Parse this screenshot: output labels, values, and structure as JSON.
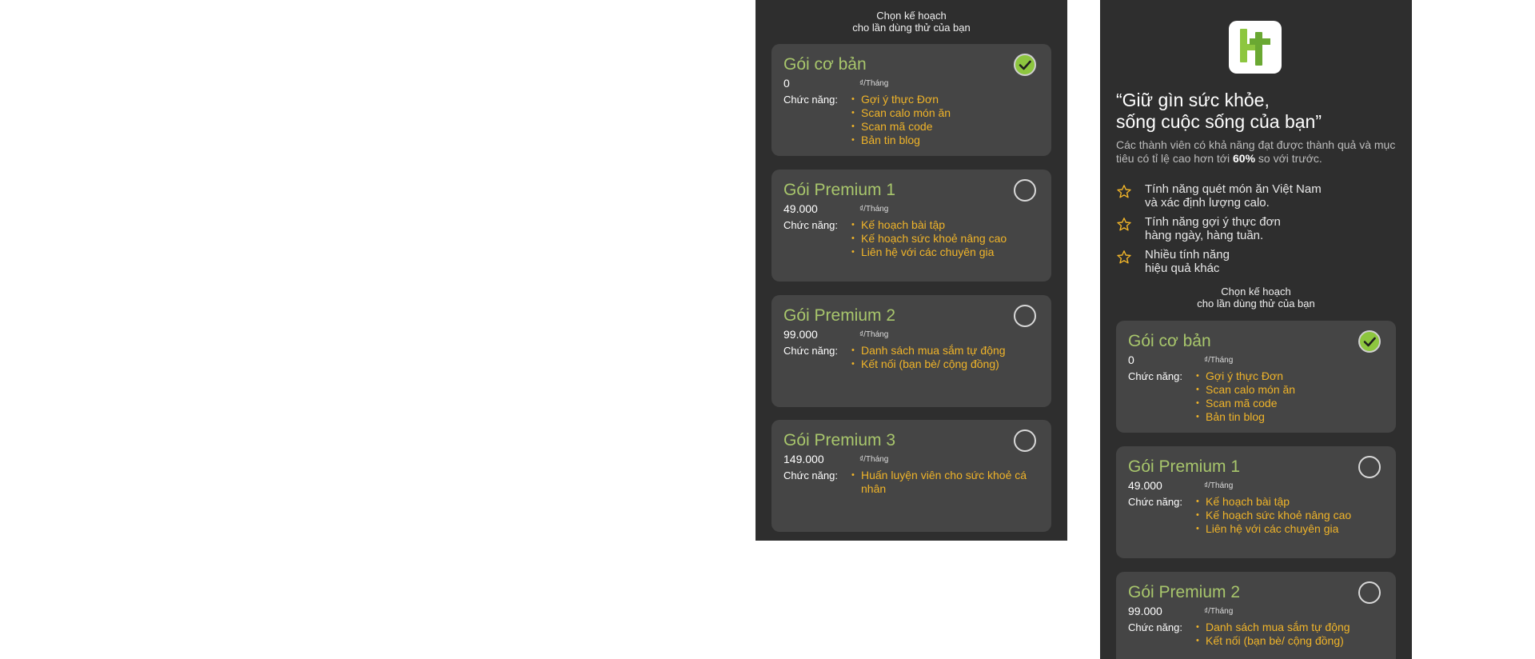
{
  "choose_plan": {
    "line1": "Chọn kế hoạch",
    "line2": "cho lần dùng thử của bạn"
  },
  "hero": {
    "quote_line1": "“Giữ gìn sức khỏe,",
    "quote_line2": "sống cuộc sống của bạn”",
    "desc_part1": "Các thành viên có khả năng đạt được thành quả và mục tiêu có tỉ lệ cao hơn tới ",
    "desc_bold": "60%",
    "desc_part2": " so với trước."
  },
  "features": [
    {
      "line1": "Tính năng quét món ăn Việt Nam",
      "line2": "và xác định lượng calo."
    },
    {
      "line1": "Tính năng gợi ý thực đơn",
      "line2": "hàng ngày, hàng tuần."
    },
    {
      "line1": "Nhiều tính năng",
      "line2": "hiệu quả khác"
    }
  ],
  "plans": [
    {
      "name": "Gói cơ bản",
      "price": "0",
      "unit": "₫/Tháng",
      "label": "Chức năng:",
      "selected": true,
      "features": [
        "Gợi ý thực Đơn",
        "Scan calo món ăn",
        "Scan mã code",
        "Bản tin blog"
      ]
    },
    {
      "name": "Gói Premium 1",
      "price": "49.000",
      "unit": "₫/Tháng",
      "label": "Chức năng:",
      "selected": false,
      "features": [
        "Kế hoạch bài tập",
        "Kế hoạch sức khoẻ nâng cao",
        "Liên hệ với các chuyên gia"
      ]
    },
    {
      "name": "Gói Premium 2",
      "price": "99.000",
      "unit": "₫/Tháng",
      "label": "Chức năng:",
      "selected": false,
      "features": [
        "Danh sách mua sắm tự động",
        "Kết nối (bạn bè/ cộng đồng)"
      ]
    },
    {
      "name": "Gói Premium 3",
      "price": "149.000",
      "unit": "₫/Tháng",
      "label": "Chức năng:",
      "selected": false,
      "features": [
        "Huấn luyện viên cho sức khoẻ cá nhân"
      ]
    }
  ],
  "colors": {
    "panel_bg": "#2e2e2e",
    "card_bg": "#454545",
    "plan_title": "#a8c66c",
    "feature_text": "#f0b429",
    "check_green": "#8dc63f"
  },
  "icons": {
    "selected": "check-circle-icon",
    "unselected": "radio-empty-icon",
    "feature": "star-hand-icon",
    "logo": "app-logo-icon"
  }
}
